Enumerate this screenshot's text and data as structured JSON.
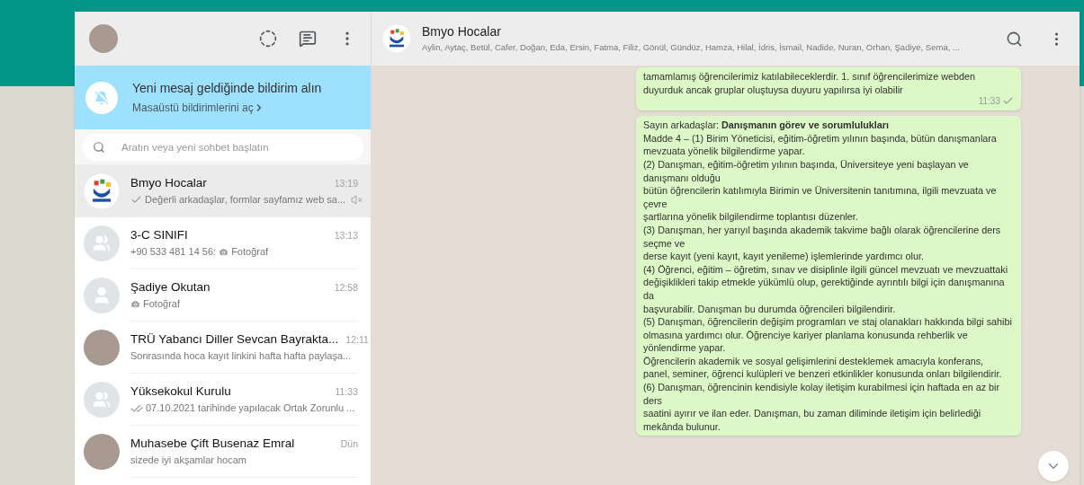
{
  "notification_banner": {
    "title": "Yeni mesaj geldiğinde bildirim alın",
    "link": "Masaüstü bildirimlerini aç"
  },
  "search": {
    "placeholder": "Aratın veya yeni sohbet başlatın"
  },
  "chats": [
    {
      "name": "Bmyo Hocalar",
      "time": "13:19",
      "kind": "logo",
      "ticked": true,
      "double_tick": false,
      "preview": "Değerli arkadaşlar, formlar sayfamız web sa...",
      "muted": true,
      "selected": true
    },
    {
      "name": "3-C SINIFI",
      "time": "13:13",
      "kind": "group",
      "sender": "+90 533 481 14 56:",
      "photo_attachment": true,
      "preview": "Fotoğraf",
      "muted": false,
      "selected": false
    },
    {
      "name": "Şadiye Okutan",
      "time": "12:58",
      "kind": "person",
      "photo_attachment": true,
      "preview": "Fotoğraf",
      "muted": false,
      "selected": false
    },
    {
      "name": "TRÜ Yabancı Diller Sevcan Bayrakta...",
      "time": "12:11",
      "kind": "photo",
      "preview": "Sonrasında hoca kayıt  linkini hafta hafta paylaşa...",
      "muted": false,
      "selected": false
    },
    {
      "name": "Yüksekokul Kurulu",
      "time": "11:33",
      "kind": "group",
      "ticked": true,
      "double_tick": true,
      "preview": "07.10.2021 tarihinde yapılacak Ortak Zorunlu ...",
      "muted": false,
      "selected": false
    },
    {
      "name": "Muhasebe Çift Busenaz Emral",
      "time": "Dün",
      "kind": "photo",
      "preview": "sizede iyi akşamlar hocam",
      "muted": false,
      "selected": false
    }
  ],
  "conversation": {
    "title": "Bmyo Hocalar",
    "members": "Aylin, Aytaç, Betül, Cafer, Doğan, Eda, Ersin, Fatma, Filiz, Gönül, Gündüz, Hamza, Hilal, İdris, İsmail, Nadide, Nuran, Orhan, Şadiye, Sema, ...",
    "messages": [
      {
        "lines": [
          "tamamlamış öğrencilerimiz katılabileceklerdir. 1. sınıf öğrencilerimize webden",
          "duyurduk ancak gruplar oluştuysa duyuru yapılırsa iyi olabilir"
        ],
        "time": "11:33",
        "ticked": true
      },
      {
        "lines": [
          "Sayın arkadaşlar: **Danışmanın görev ve sorumlulukları**",
          "Madde 4 – (1) Birim Yöneticisi, eğitim-öğretim yılının başında, bütün danışmanlara",
          "mevzuata yönelik bilgilendirme yapar.",
          "(2) Danışman, eğitim-öğretim yılının başında, Üniversiteye yeni başlayan ve danışmanı olduğu",
          "bütün öğrencilerin katılımıyla Birimin ve Üniversitenin tanıtımına, ilgili mevzuata ve çevre",
          "şartlarına yönelik bilgilendirme toplantısı düzenler.",
          "(3) Danışman, her yarıyıl başında akademik takvime bağlı olarak öğrencilerine ders seçme ve",
          "derse kayıt (yeni kayıt, kayıt yenileme) işlemlerinde yardımcı olur.",
          "(4) Öğrenci, eğitim – öğretim, sınav ve disiplinle ilgili güncel mevzuatı ve mevzuattaki",
          "değişiklikleri takip etmekle yükümlü olup, gerektiğinde ayrıntılı bilgi için danışmanına da",
          "başvurabilir. Danışman bu durumda öğrencileri bilgilendirir.",
          "(5) Danışman, öğrencilerin değişim programları ve staj olanakları hakkında bilgi sahibi",
          "olmasına yardımcı olur. Öğrenciye kariyer planlama konusunda rehberlik ve yönlendirme yapar.",
          "Öğrencilerin akademik ve sosyal gelişimlerini desteklemek amacıyla konferans,",
          "panel, seminer, öğrenci kulüpleri ve benzeri etkinlikler konusunda onları bilgilendirir.",
          "(6) Danışman, öğrencinin kendisiyle kolay iletişim kurabilmesi için haftada en az bir ders",
          "saatini ayırır ve ilan eder. Danışman, bu zaman diliminde iletişim için belirlediği",
          "mekânda bulunur."
        ]
      }
    ]
  }
}
